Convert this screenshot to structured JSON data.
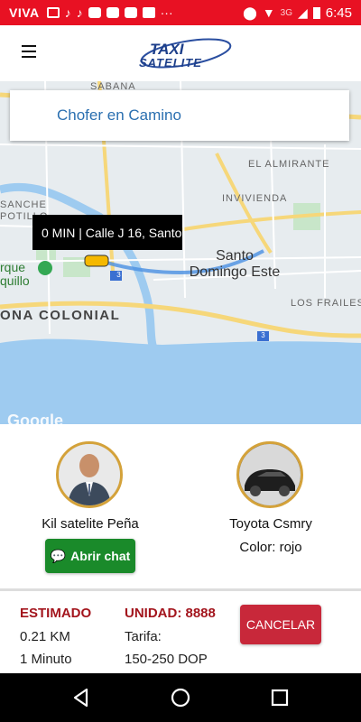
{
  "status_bar": {
    "carrier": "VIVA",
    "network": "3G",
    "time": "6:45",
    "icons": [
      "message-icon",
      "tiktok-icon",
      "tiktok-icon",
      "youtube-icon",
      "youtube-icon",
      "youtube-icon",
      "facebook-icon",
      "more-icon",
      "location-icon",
      "wifi-icon",
      "signal-icon",
      "battery-icon"
    ],
    "bg_color": "#e81123"
  },
  "app_bar": {
    "logo_text_top": "TAXI",
    "logo_text_bottom": "SATELITE"
  },
  "map": {
    "status_card": "Chofer en Camino",
    "eta_bubble": "0 MIN | Calle J 16, Santo",
    "labels": {
      "sabana": "SABANA",
      "el_almirante": "EL ALMIRANTE",
      "invivienda": "INVIVIENDA",
      "sanche": "SANCHE",
      "potillo": "POTILLO",
      "santo_domingo_este": "Santo\nDomingo Este",
      "parque_a": "rque",
      "parque_b": "quillo",
      "zona_colonial": "ONA COLONIAL",
      "los_frailes": "LOS FRAILES",
      "hwy_3": "3",
      "google": "Google"
    }
  },
  "driver": {
    "name": "Kil satelite Peña",
    "chat_button": "Abrir chat"
  },
  "vehicle": {
    "model": "Toyota  Csmry",
    "color_text": "Color: rojo"
  },
  "trip": {
    "estimated_label": "ESTIMADO",
    "distance": "0.21 KM",
    "duration": "1 Minuto",
    "unit_label": "UNIDAD: 8888",
    "fare_label": "Tarifa:",
    "fare_value": "150-250 DOP",
    "cancel_button": "CANCELAR"
  },
  "colors": {
    "accent_red": "#a3151d",
    "cancel_red": "#c8283a",
    "chat_green": "#1a8a2a",
    "link_blue": "#2a6fb0"
  }
}
